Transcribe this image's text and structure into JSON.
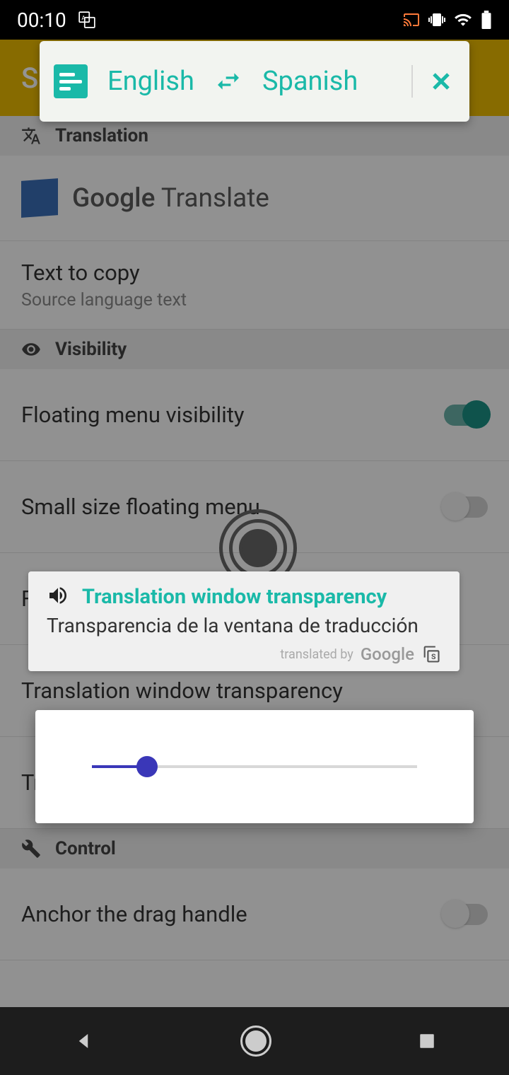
{
  "status": {
    "time": "00:10"
  },
  "appBar": {
    "title": "Settings"
  },
  "sections": {
    "translation": "Translation",
    "visibility": "Visibility",
    "control": "Control"
  },
  "settings": {
    "googleTranslate": {
      "word1": "Google",
      "word2": "Translate"
    },
    "textToCopy": {
      "title": "Text to copy",
      "sub": "Source language text"
    },
    "floatingMenuVisibility": {
      "title": "Floating menu visibility",
      "on": true
    },
    "smallSize": {
      "title": "Small size floating menu",
      "on": false
    },
    "floatingMenuTransparency": {
      "title": "Floating menu transparency"
    },
    "translationWindowTransparency": {
      "title": "Translation window transparency"
    },
    "translationWindowSize": {
      "title": "Translation window size"
    },
    "anchorDrag": {
      "title": "Anchor the drag handle",
      "on": false
    }
  },
  "translateBar": {
    "source": "English",
    "target": "Spanish"
  },
  "translationCard": {
    "source": "Translation window transparency",
    "target": "Transparencia de la ventana de traducción",
    "footer1": "translated by",
    "footer2": "Google"
  },
  "slider": {
    "percent": 17
  },
  "colors": {
    "accent": "#1ab9a8",
    "primary": "#3a37b8"
  }
}
